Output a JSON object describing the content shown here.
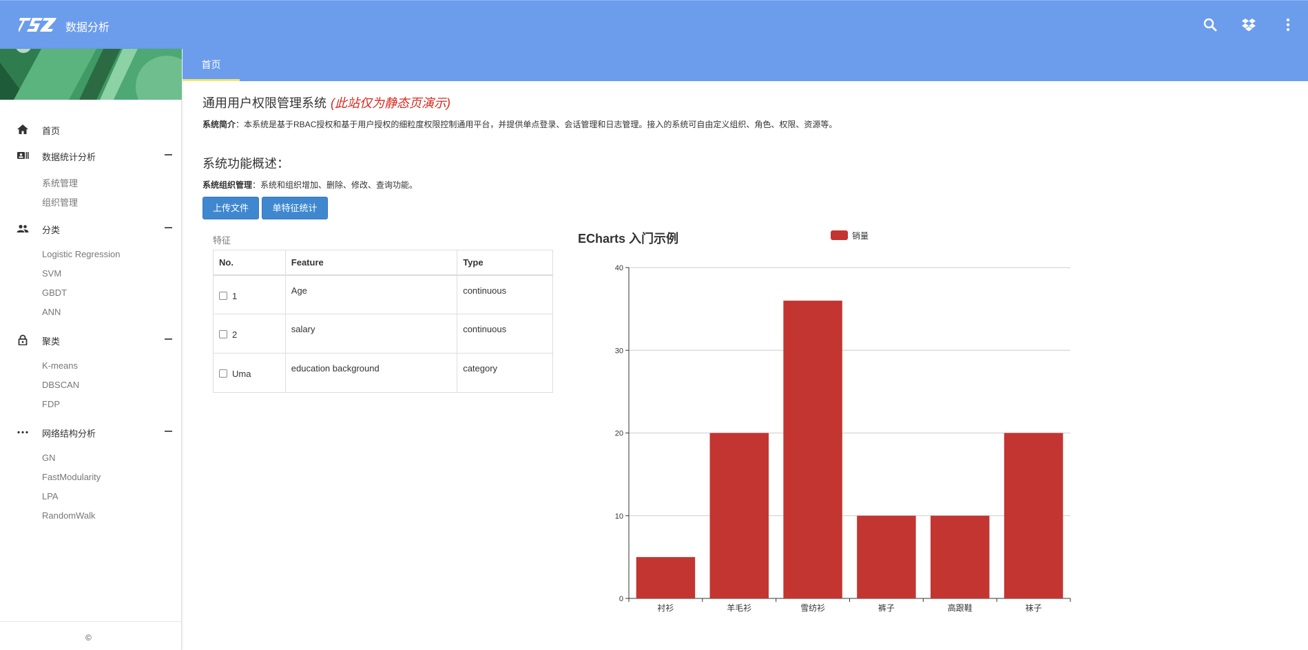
{
  "app": {
    "title": "数据分析"
  },
  "colors": {
    "header": "#6c9ded",
    "bar": "#c23531",
    "button": "#3f88cf",
    "demo_text": "#d9261c"
  },
  "topbar_icons": [
    "search-icon",
    "dropbox-icon",
    "more-vert-icon"
  ],
  "sidebar": {
    "items": [
      {
        "label": "首页",
        "icon": "home-icon"
      },
      {
        "label": "数据统计分析",
        "icon": "contact-card-icon",
        "children": [
          "系统管理",
          "组织管理"
        ]
      },
      {
        "label": "分类",
        "icon": "people-icon",
        "children": [
          "Logistic Regression",
          "SVM",
          "GBDT",
          "ANN"
        ]
      },
      {
        "label": "聚类",
        "icon": "lock-icon",
        "children": [
          "K-means",
          "DBSCAN",
          "FDP"
        ]
      },
      {
        "label": "网络结构分析",
        "icon": "more-horiz-icon",
        "children": [
          "GN",
          "FastModularity",
          "LPA",
          "RandomWalk"
        ]
      }
    ],
    "footer": "©"
  },
  "tabs": [
    {
      "label": "首页"
    }
  ],
  "main": {
    "heading": "通用用户权限管理系统",
    "heading_note": "(此站仅为静态页演示)",
    "intro_label": "系统简介",
    "intro_text": "：本系统是基于RBAC授权和基于用户授权的细粒度权限控制通用平台，并提供单点登录、会话管理和日志管理。接入的系统可自由定义组织、角色、权限、资源等。",
    "section_title": "系统功能概述：",
    "org_label": "系统组织管理",
    "org_text": "：系统和组织增加、删除、修改、查询功能。",
    "upload_button": "上传文件",
    "stats_button": "单特征统计"
  },
  "features": {
    "caption": "特征",
    "columns": [
      "No.",
      "Feature",
      "Type"
    ],
    "rows": [
      {
        "no": "1",
        "feature": "Age",
        "type": "continuous",
        "checked": false
      },
      {
        "no": "2",
        "feature": "salary",
        "type": "continuous",
        "checked": false
      },
      {
        "no": "Uma",
        "feature": "education background",
        "type": "category",
        "checked": false
      }
    ]
  },
  "chart_data": {
    "type": "bar",
    "title": "ECharts 入门示例",
    "categories": [
      "衬衫",
      "羊毛衫",
      "雪纺衫",
      "裤子",
      "高跟鞋",
      "袜子"
    ],
    "series": [
      {
        "name": "销量",
        "values": [
          5,
          20,
          36,
          10,
          10,
          20
        ]
      }
    ],
    "ylim": [
      0,
      40
    ],
    "yticks": [
      0,
      10,
      20,
      30,
      40
    ],
    "grid": true,
    "legend_position": "top-center"
  }
}
